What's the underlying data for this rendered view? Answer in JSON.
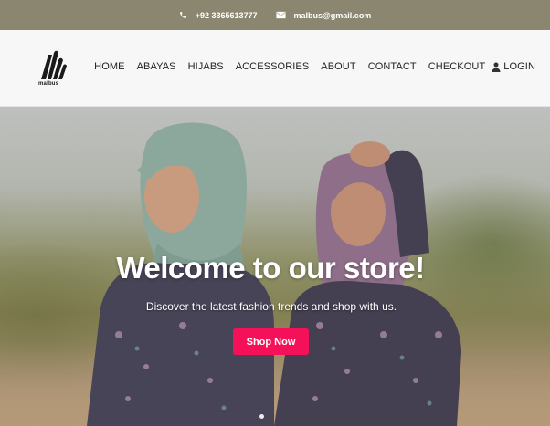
{
  "topbar": {
    "phone": "+92 3365613777",
    "email": "malbus@gmail.com",
    "phone_icon": "phone-icon",
    "email_icon": "envelope-icon"
  },
  "brand": {
    "name": "malbus"
  },
  "nav": {
    "items": [
      "HOME",
      "ABAYAS",
      "HIJABS",
      "ACCESSORIES",
      "ABOUT",
      "CONTACT",
      "CHECKOUT"
    ],
    "login": "LOGIN",
    "login_icon": "user-icon"
  },
  "hero": {
    "title": "Welcome to our store!",
    "subtitle": "Discover the latest fashion trends and shop with us.",
    "cta": "Shop Now",
    "slide_count": 1,
    "active_slide": 1
  },
  "colors": {
    "topbar_bg": "#8b8670",
    "navbar_bg": "#f7f7f7",
    "cta_bg": "#f5115a",
    "text_dark": "#222222"
  }
}
